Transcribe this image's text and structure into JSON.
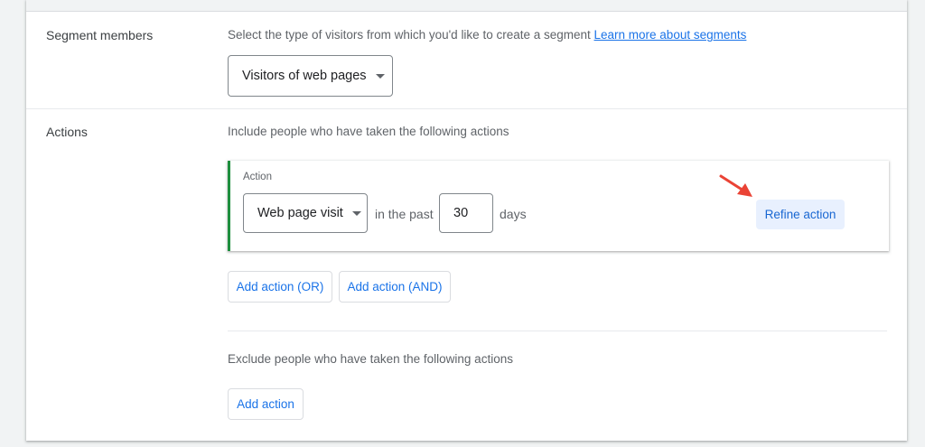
{
  "segment_members": {
    "label": "Segment members",
    "description": "Select the type of visitors from which you'd like to create a segment ",
    "learn_more_link": "Learn more about segments",
    "visitor_type_selected": "Visitors of web pages"
  },
  "actions": {
    "label": "Actions",
    "include_description": "Include people who have taken the following actions",
    "action_card": {
      "title": "Action",
      "action_type_selected": "Web page visit",
      "in_the_past_text": "in the past",
      "days_value": "30",
      "days_text": "days",
      "refine_button": "Refine action"
    },
    "add_or_button": "Add action (OR)",
    "add_and_button": "Add action (AND)",
    "exclude_description": "Exclude people who have taken the following actions",
    "add_action_button": "Add action"
  },
  "colors": {
    "accent_blue": "#1a73e8",
    "action_border_green": "#1e8e3e",
    "annotation_arrow_red": "#ea4335"
  },
  "icons": {
    "dropdown": "caret-down-icon",
    "annotation": "red-arrow-icon"
  }
}
